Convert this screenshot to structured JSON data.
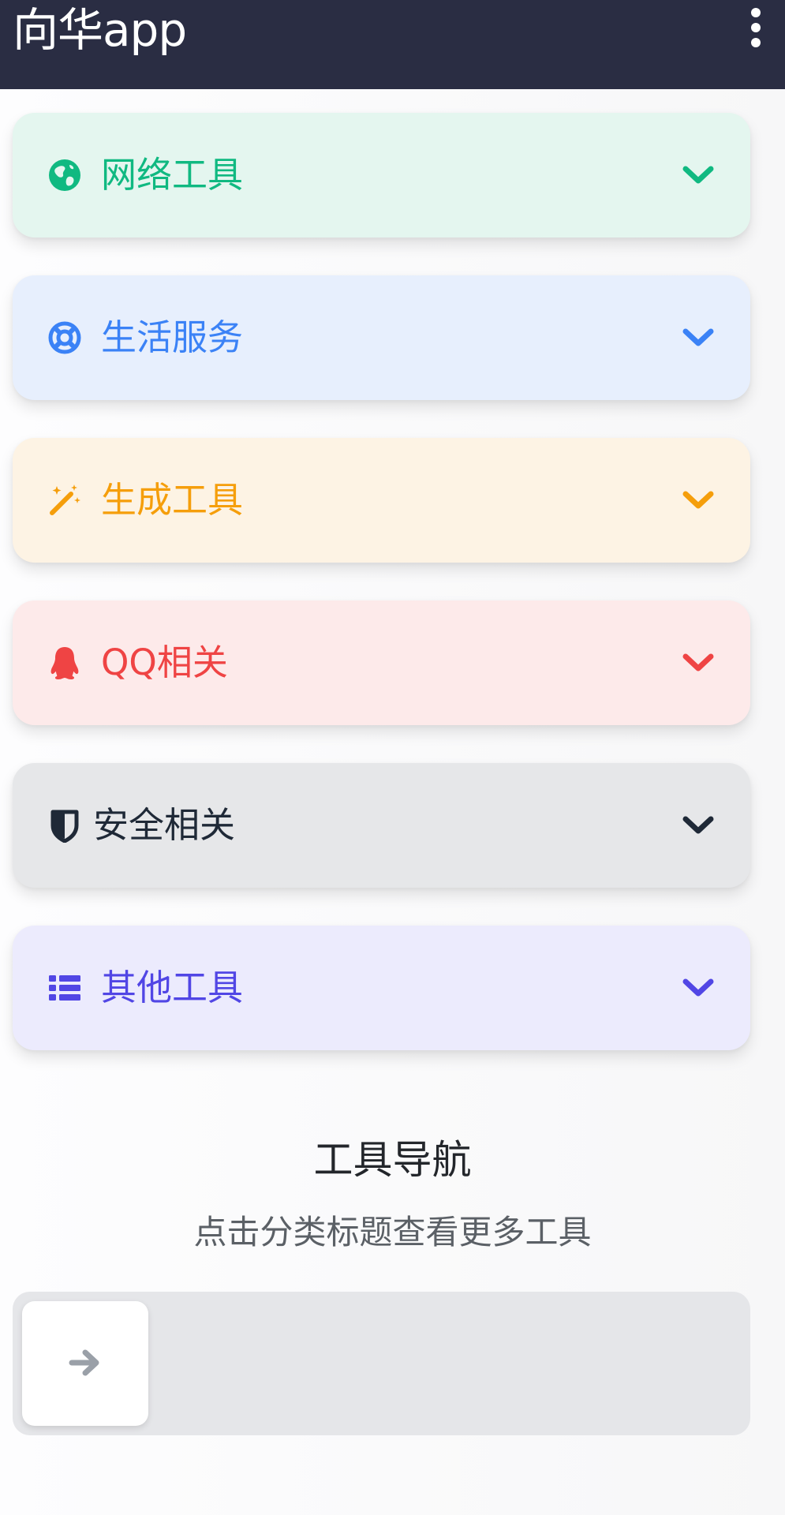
{
  "app": {
    "title": "向华app",
    "menu_icon": "more-vertical-icon"
  },
  "categories": [
    {
      "label": "网络工具",
      "icon": "globe-icon",
      "color": "#10b981",
      "bg": "#e4f6ef"
    },
    {
      "label": "生活服务",
      "icon": "lifebuoy-icon",
      "color": "#3b82f6",
      "bg": "#e7effd"
    },
    {
      "label": "生成工具",
      "icon": "magic-wand-icon",
      "color": "#f59e0b",
      "bg": "#fdf3e4"
    },
    {
      "label": "QQ相关",
      "icon": "qq-penguin-icon",
      "color": "#ef4444",
      "bg": "#fdeaea"
    },
    {
      "label": "安全相关",
      "icon": "shield-icon",
      "color": "#1f2937",
      "bg": "#e6e7e9"
    },
    {
      "label": "其他工具",
      "icon": "list-icon",
      "color": "#5146e5",
      "bg": "#ecebfd"
    }
  ],
  "nav": {
    "title": "工具导航",
    "subtitle": "点击分类标题查看更多工具"
  },
  "slider": {
    "handle_icon": "arrow-right-icon",
    "progress": 0
  }
}
